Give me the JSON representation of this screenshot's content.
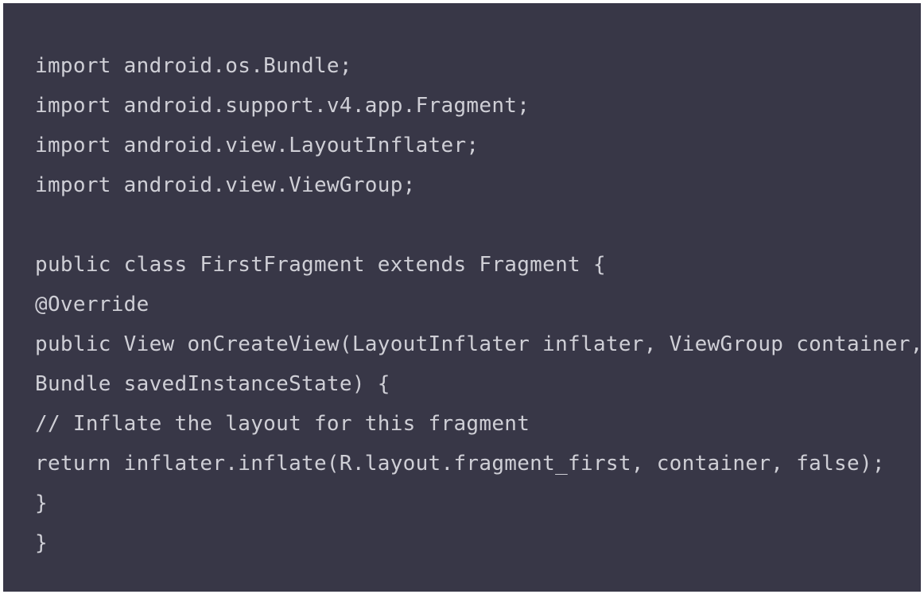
{
  "code_block": {
    "background_color": "#383747",
    "text_color": "#cfcfd6",
    "lines": [
      "import android.os.Bundle;",
      "import android.support.v4.app.Fragment;",
      "import android.view.LayoutInflater;",
      "import android.view.ViewGroup;",
      "",
      "public class FirstFragment extends Fragment {",
      "@Override",
      "public View onCreateView(LayoutInflater inflater, ViewGroup container,",
      "Bundle savedInstanceState) {",
      "// Inflate the layout for this fragment",
      "return inflater.inflate(R.layout.fragment_first, container, false);",
      "}",
      "}"
    ]
  }
}
